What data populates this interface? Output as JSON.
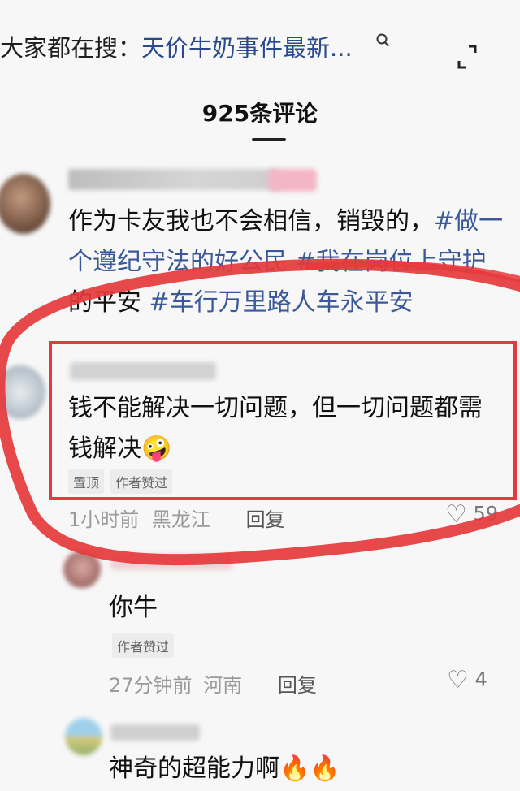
{
  "search": {
    "prefix": "大家都在搜：",
    "keyword": "天价牛奶事件最新...",
    "icon": "search-icon"
  },
  "header": {
    "comment_count": "925条评论"
  },
  "comments": [
    {
      "text_line1": "作为卡友我也不会相信，销毁的，",
      "tag1": "#做一",
      "text_line2_tag": "个遵纪守法的好公民 #我在岗位上守护",
      "text_line3_prefix": "的平安 ",
      "tag3": "#车行万里路人车永平安"
    },
    {
      "text_line1": "钱不能解决一切问题，但一切问题都需",
      "text_line2": "钱解决",
      "emoji": "🤪",
      "badge_pinned": "置顶",
      "badge_liked": "作者赞过",
      "time": "1小时前",
      "location": "黑龙江",
      "reply_label": "回复",
      "likes": "59"
    },
    {
      "text": "你牛",
      "badge_liked": "作者赞过",
      "time": "27分钟前",
      "location": "河南",
      "reply_label": "回复",
      "likes": "4"
    },
    {
      "text": "神奇的超能力啊"
    }
  ],
  "colors": {
    "highlight_red": "#e5393c",
    "hashtag_blue": "#3b5998"
  }
}
